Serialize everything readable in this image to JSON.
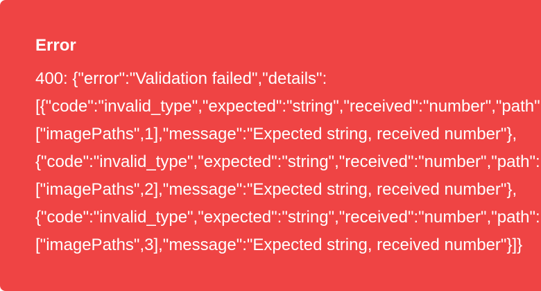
{
  "toast": {
    "title": "Error",
    "lines": [
      "400: {\"error\":\"Validation failed\",\"details\":",
      "[{\"code\":\"invalid_type\",\"expected\":\"string\",\"received\":\"number\",\"path\":",
      "[\"imagePaths\",1],\"message\":\"Expected string, received number\"},",
      "{\"code\":\"invalid_type\",\"expected\":\"string\",\"received\":\"number\",\"path\":",
      "[\"imagePaths\",2],\"message\":\"Expected string, received number\"},",
      "{\"code\":\"invalid_type\",\"expected\":\"string\",\"received\":\"number\",\"path\":",
      "[\"imagePaths\",3],\"message\":\"Expected string, received number\"}]}"
    ],
    "colors": {
      "background": "#ef4444",
      "text": "#ffffff"
    }
  }
}
